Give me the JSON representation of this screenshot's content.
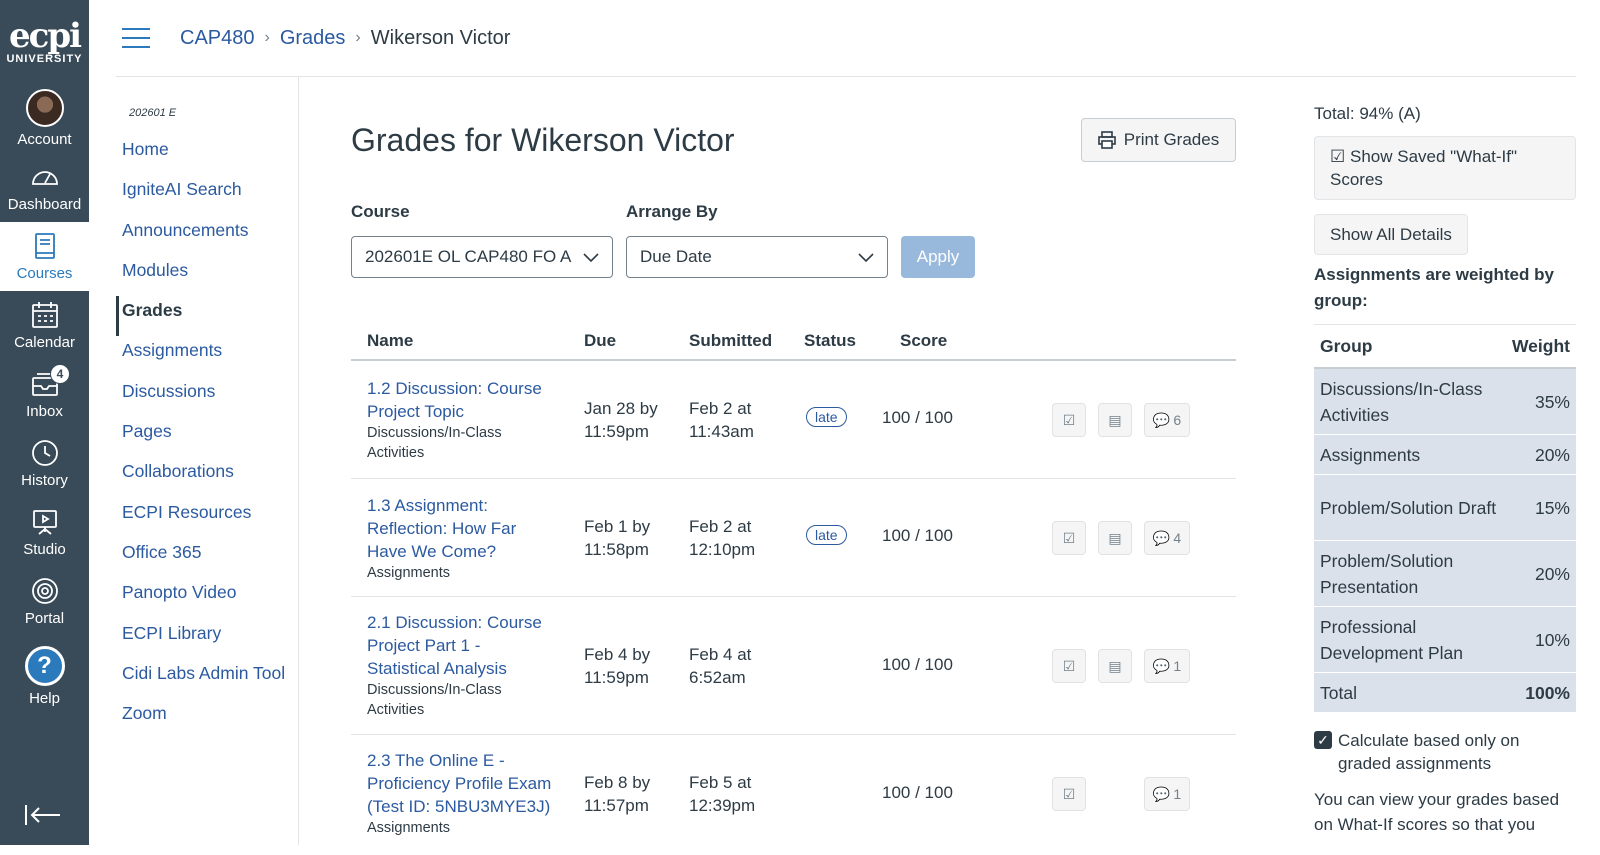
{
  "global_nav": {
    "logo_main": "ecpi",
    "logo_sub": "UNIVERSITY",
    "items": [
      {
        "label": "Account",
        "icon": "avatar"
      },
      {
        "label": "Dashboard",
        "icon": "dashboard-icon"
      },
      {
        "label": "Courses",
        "icon": "courses-icon",
        "active": true
      },
      {
        "label": "Calendar",
        "icon": "calendar-icon"
      },
      {
        "label": "Inbox",
        "icon": "inbox-icon",
        "badge": "4"
      },
      {
        "label": "History",
        "icon": "history-icon"
      },
      {
        "label": "Studio",
        "icon": "studio-icon"
      },
      {
        "label": "Portal",
        "icon": "portal-icon"
      },
      {
        "label": "Help",
        "icon": "help-icon"
      }
    ]
  },
  "breadcrumb": [
    "CAP480",
    "Grades",
    "Wikerson Victor"
  ],
  "course_nav": {
    "term": "202601 E",
    "items": [
      "Home",
      "IgniteAI Search",
      "Announcements",
      "Modules",
      "Grades",
      "Assignments",
      "Discussions",
      "Pages",
      "Collaborations",
      "ECPI Resources",
      "Office 365",
      "Panopto Video",
      "ECPI Library",
      "Cidi Labs Admin Tool",
      "Zoom"
    ],
    "active": "Grades"
  },
  "main": {
    "title": "Grades for Wikerson Victor",
    "print_label": "Print Grades",
    "course_label": "Course",
    "course_value": "202601E OL CAP480 FO A",
    "arrange_label": "Arrange By",
    "arrange_value": "Due Date",
    "apply_label": "Apply"
  },
  "table": {
    "headers": [
      "Name",
      "Due",
      "Submitted",
      "Status",
      "Score"
    ],
    "rows": [
      {
        "name": "1.2 Discussion: Course Project Topic",
        "group": "Discussions/In-Class Activities",
        "due": "Jan 28 by 11:59pm",
        "submitted": "Feb 2 at 11:43am",
        "status": "late",
        "score": "100 / 100",
        "comments": "6",
        "rubric": true
      },
      {
        "name": "1.3 Assignment: Reflection: How Far Have We Come?",
        "group": "Assignments",
        "due": "Feb 1 by 11:58pm",
        "submitted": "Feb 2 at 12:10pm",
        "status": "late",
        "score": "100 / 100",
        "comments": "4",
        "rubric": true
      },
      {
        "name": "2.1 Discussion: Course Project Part 1 - Statistical Analysis",
        "group": "Discussions/In-Class Activities",
        "due": "Feb 4 by 11:59pm",
        "submitted": "Feb 4 at 6:52am",
        "status": "",
        "score": "100 / 100",
        "comments": "1",
        "rubric": true
      },
      {
        "name": "2.3 The Online E - Proficiency Profile Exam (Test ID: 5NBU3MYE3J)",
        "group": "Assignments",
        "due": "Feb 8 by 11:57pm",
        "submitted": "Feb 5 at 12:39pm",
        "status": "",
        "score": "100 / 100",
        "comments": "1",
        "rubric": false
      }
    ]
  },
  "sidebar": {
    "total": "Total: 94% (A)",
    "show_saved": "Show Saved \"What-If\" Scores",
    "show_all": "Show All Details",
    "weighted_note": "Assignments are weighted by group:",
    "weights_headers": [
      "Group",
      "Weight"
    ],
    "weights": [
      {
        "group": "Discussions/In-Class Activities",
        "weight": "35%"
      },
      {
        "group": "Assignments",
        "weight": "20%"
      },
      {
        "group": "Problem/Solution Draft",
        "weight": "15%"
      },
      {
        "group": "Problem/Solution Presentation",
        "weight": "20%"
      },
      {
        "group": "Professional Development Plan",
        "weight": "10%"
      },
      {
        "group": "Total",
        "weight": "100%"
      }
    ],
    "calc_label": "Calculate based only on graded assignments",
    "info_text": "You can view your grades based on What-If scores so that you"
  }
}
